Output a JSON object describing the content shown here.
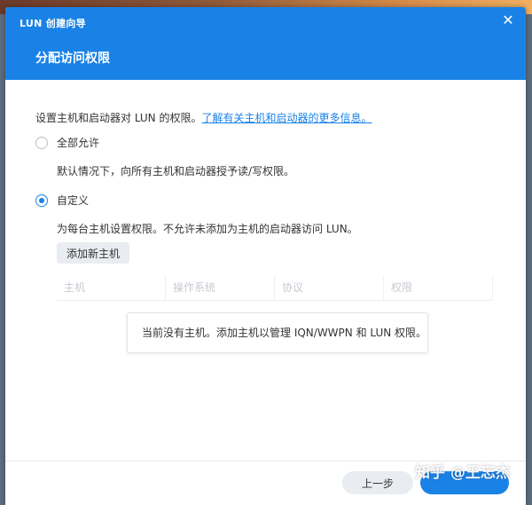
{
  "dialog": {
    "wizard_title": "LUN 创建向导",
    "step_title": "分配访问权限",
    "close_symbol": "✕",
    "colors": {
      "header": "#1a82e7",
      "accent": "#1a82e7"
    }
  },
  "content": {
    "intro_text": "设置主机和启动器对 LUN 的权限。",
    "intro_link": "了解有关主机和启动器的更多信息。",
    "options": [
      {
        "label": "全部允许",
        "checked": false,
        "description": "默认情况下，向所有主机和启动器授予读/写权限。"
      },
      {
        "label": "自定义",
        "checked": true,
        "description": "为每台主机设置权限。不允许未添加为主机的启动器访问 LUN。"
      }
    ],
    "add_host_label": "添加新主机",
    "table": {
      "columns": [
        "主机",
        "操作系统",
        "协议",
        "权限"
      ],
      "empty_message": "当前没有主机。添加主机以管理 IQN/WWPN 和 LUN 权限。"
    }
  },
  "footer": {
    "prev_label": "上一步",
    "watermark": "知乎 @王忘杰"
  }
}
